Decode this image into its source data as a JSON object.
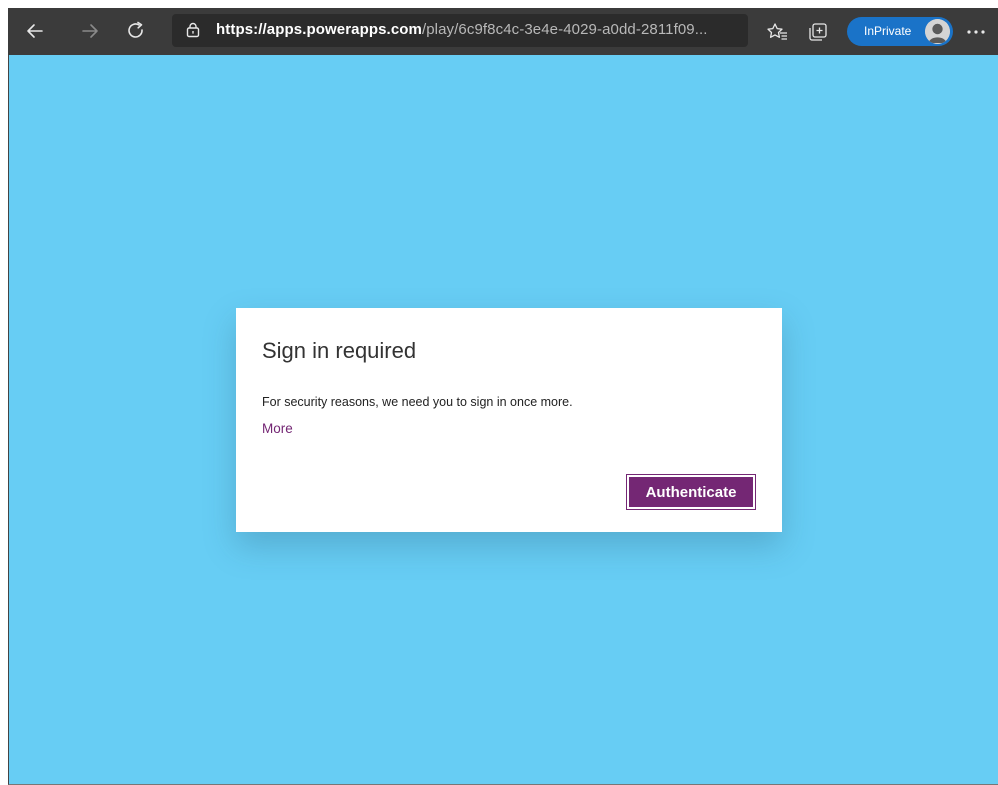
{
  "browser": {
    "url_host": "https://apps.powerapps.com",
    "url_path": "/play/6c9f8c4c-3e4e-4029-a0dd-2811f09...",
    "inprivate_label": "InPrivate",
    "icons": {
      "back": "back-arrow-icon",
      "forward": "forward-arrow-icon",
      "refresh": "refresh-icon",
      "lock": "lock-icon",
      "add_favorite": "add-favorite-icon",
      "favorites": "favorites-icon",
      "collections": "collections-icon",
      "avatar": "avatar",
      "more": "more-icon"
    },
    "colors": {
      "toolbar": "#3b3b3b",
      "inprivate": "#1a73c8"
    }
  },
  "page": {
    "background_color": "#67cdf4"
  },
  "dialog": {
    "title": "Sign in required",
    "message": "For security reasons, we need you to sign in once more.",
    "more_link": "More",
    "button_label": "Authenticate",
    "accent_color": "#742774"
  }
}
